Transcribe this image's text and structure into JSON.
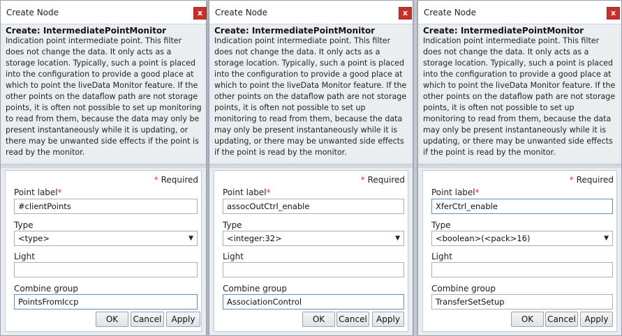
{
  "dialogs": [
    {
      "title": "Create Node",
      "close_label": "x",
      "heading": "Create:  IntermediatePointMonitor",
      "description": "Indication point intermediate point. This filter does not change the data. It only acts as a storage location. Typically, such a point is placed into the configuration to provide a good place at which to point the liveData Monitor feature. If the other points on the dataflow path are not storage points, it is often not possible to set up monitoring to read from them, because the data may only be present instantaneously while it is updating, or there may be unwanted side effects if the point is read by the monitor.",
      "required_note": "Required",
      "required_star": "*",
      "point_label": "Point label",
      "point_value": "#clientPoints",
      "type_label": "Type",
      "type_value": "<type>",
      "light_label": "Light",
      "light_value": "",
      "combine_label": "Combine group",
      "combine_value": "PointsFromIccp",
      "ok": "OK",
      "cancel": "Cancel",
      "apply": "Apply"
    },
    {
      "title": "Create Node",
      "close_label": "x",
      "heading": "Create:  IntermediatePointMonitor",
      "description": "Indication point intermediate point. This filter does not change the data. It only acts as a storage location. Typically, such a point is placed into the configuration to provide a good place at which to point the liveData Monitor feature. If the other points on the dataflow path are not storage points, it is often not possible to set up monitoring to read from them, because the data may only be present instantaneously while it is updating, or there may be unwanted side effects if the point is read by the monitor.",
      "required_note": "Required",
      "required_star": "*",
      "point_label": "Point label",
      "point_value": "assocOutCtrl_enable",
      "type_label": "Type",
      "type_value": "<integer:32>",
      "light_label": "Light",
      "light_value": "",
      "combine_label": "Combine group",
      "combine_value": "AssociationControl",
      "ok": "OK",
      "cancel": "Cancel",
      "apply": "Apply"
    },
    {
      "title": "Create Node",
      "close_label": "x",
      "heading": "Create:  IntermediatePointMonitor",
      "description": "Indication point intermediate point. This filter does not change the data. It only acts as a storage location. Typically, such a point is placed into the configuration to provide a good place at which to point the liveData Monitor feature. If the other points on the dataflow path are not storage points, it is often not possible to set up monitoring to read from them, because the data may only be present instantaneously while it is updating, or there may be unwanted side effects if the point is read by the monitor.",
      "required_note": "Required",
      "required_star": "*",
      "point_label": "Point label",
      "point_value": "XferCtrl_enable",
      "type_label": "Type",
      "type_value": "<boolean>(<pack>16)",
      "light_label": "Light",
      "light_value": "",
      "combine_label": "Combine group",
      "combine_value": "TransferSetSetup",
      "ok": "OK",
      "cancel": "Cancel",
      "apply": "Apply"
    }
  ]
}
